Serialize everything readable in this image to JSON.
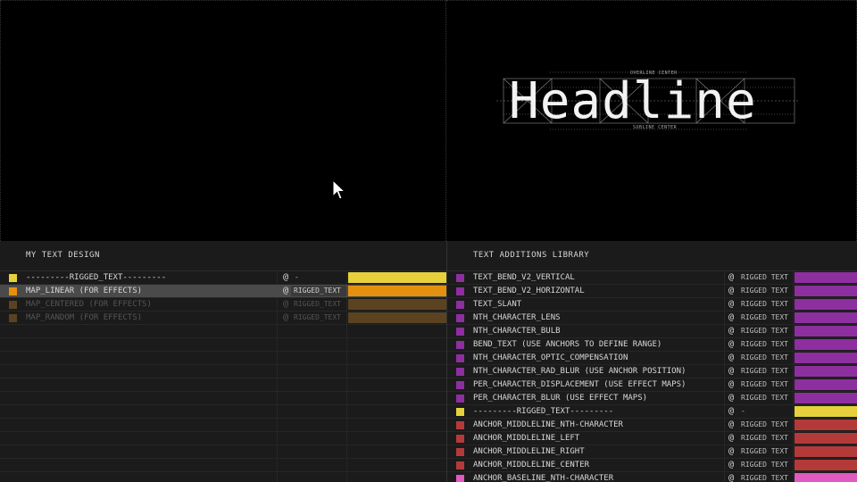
{
  "viewport_right": {
    "headline": "Headline",
    "overline_label": "OVERLINE CENTER",
    "subline_label": "SUBLINE CENTER"
  },
  "left_panel": {
    "title": "MY TEXT DESIGN",
    "rows": [
      {
        "name": "---------RIGGED_TEXT---------",
        "tag": "-",
        "swatch": "#e6d13c",
        "bar": "#e6d13c",
        "state": "normal"
      },
      {
        "name": "MAP_LINEAR (FOR EFFECTS)",
        "tag": "RIGGED_TEXT",
        "swatch": "#e4900f",
        "bar": "#e4900f",
        "state": "selected"
      },
      {
        "name": "MAP_CENTERED (FOR EFFECTS)",
        "tag": "RIGGED_TEXT",
        "swatch": "#5b4322",
        "bar": "#5b4322",
        "state": "dim"
      },
      {
        "name": "MAP_RANDOM (FOR EFFECTS)",
        "tag": "RIGGED_TEXT",
        "swatch": "#5b4322",
        "bar": "#5b4322",
        "state": "dim"
      }
    ]
  },
  "right_panel": {
    "title": "TEXT ADDITIONS LIBRARY",
    "rows": [
      {
        "name": "TEXT_BEND_V2_VERTICAL",
        "tag": "RIGGED TEXT",
        "color": "#8e2fa0"
      },
      {
        "name": "TEXT_BEND_V2_HORIZONTAL",
        "tag": "RIGGED TEXT",
        "color": "#8e2fa0"
      },
      {
        "name": "TEXT_SLANT",
        "tag": "RIGGED TEXT",
        "color": "#8e2fa0"
      },
      {
        "name": "NTH_CHARACTER_LENS",
        "tag": "RIGGED TEXT",
        "color": "#8e2fa0"
      },
      {
        "name": "NTH_CHARACTER_BULB",
        "tag": "RIGGED TEXT",
        "color": "#8e2fa0"
      },
      {
        "name": "BEND_TEXT (USE ANCHORS TO DEFINE RANGE)",
        "tag": "RIGGED TEXT",
        "color": "#8e2fa0"
      },
      {
        "name": "NTH_CHARACTER_OPTIC_COMPENSATION",
        "tag": "RIGGED TEXT",
        "color": "#8e2fa0"
      },
      {
        "name": "NTH_CHARACTER_RAD_BLUR (USE ANCHOR POSITION)",
        "tag": "RIGGED TEXT",
        "color": "#8e2fa0"
      },
      {
        "name": "PER_CHARACTER_DISPLACEMENT (USE EFFECT MAPS)",
        "tag": "RIGGED TEXT",
        "color": "#8e2fa0"
      },
      {
        "name": "PER_CHARACTER_BLUR (USE EFFECT MAPS)",
        "tag": "RIGGED TEXT",
        "color": "#8e2fa0"
      },
      {
        "name": "---------RIGGED_TEXT---------",
        "tag": "-",
        "color": "#e6d13c"
      },
      {
        "name": "ANCHOR_MIDDLELINE_NTH-CHARACTER",
        "tag": "RIGGED TEXT",
        "color": "#b43a3a"
      },
      {
        "name": "ANCHOR_MIDDLELINE_LEFT",
        "tag": "RIGGED TEXT",
        "color": "#b43a3a"
      },
      {
        "name": "ANCHOR_MIDDLELINE_RIGHT",
        "tag": "RIGGED TEXT",
        "color": "#b43a3a"
      },
      {
        "name": "ANCHOR_MIDDLELINE_CENTER",
        "tag": "RIGGED TEXT",
        "color": "#b43a3a"
      },
      {
        "name": "ANCHOR_BASELINE_NTH-CHARACTER",
        "tag": "RIGGED TEXT",
        "color": "#e05ac0"
      }
    ]
  }
}
